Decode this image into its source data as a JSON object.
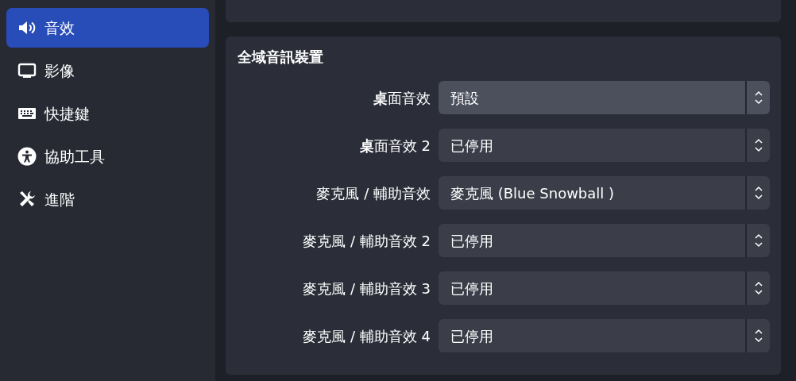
{
  "sidebar": {
    "items": [
      {
        "label": "音效",
        "selected": true
      },
      {
        "label": "影像",
        "selected": false
      },
      {
        "label": "快捷鍵",
        "selected": false
      },
      {
        "label": "協助工具",
        "selected": false
      },
      {
        "label": "進階",
        "selected": false
      }
    ]
  },
  "group": {
    "title": "全域音訊裝置",
    "rows": [
      {
        "label": "**桌**面音效",
        "value": "預設",
        "highlighted": true
      },
      {
        "label": "**桌**面音效 2",
        "value": "已停用",
        "highlighted": false
      },
      {
        "label": "麥克風 / 輔助音效",
        "value": "麥克風 (Blue Snowball )",
        "highlighted": false
      },
      {
        "label": "麥克風 / 輔助音效 2",
        "value": "已停用",
        "highlighted": false
      },
      {
        "label": "麥克風 / 輔助音效 3",
        "value": "已停用",
        "highlighted": false
      },
      {
        "label": "麥克風 / 輔助音效 4",
        "value": "已停用",
        "highlighted": false
      }
    ]
  }
}
